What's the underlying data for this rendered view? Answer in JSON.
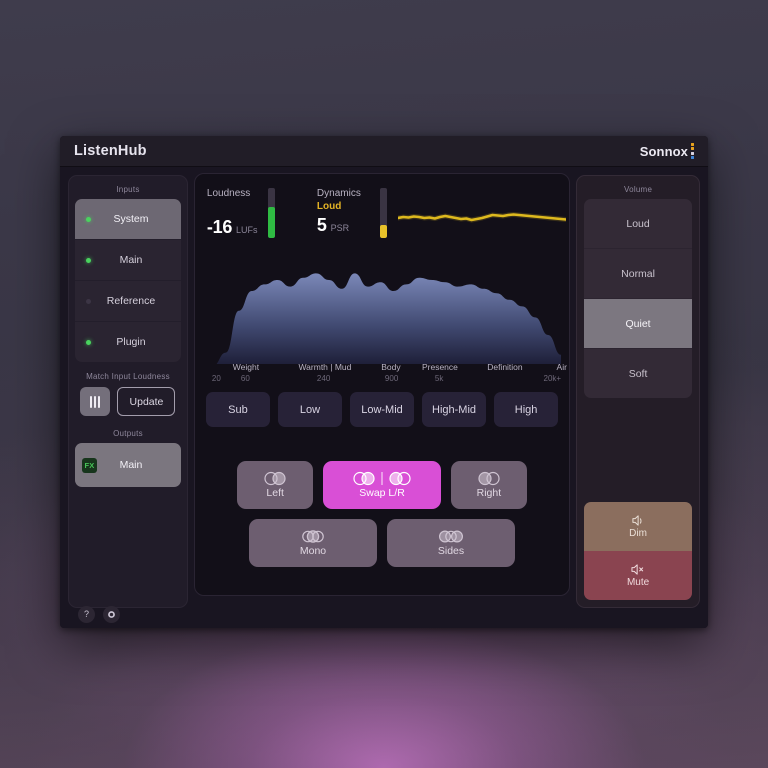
{
  "window": {
    "app_title": "ListenHub",
    "brand": "Sonnox",
    "brand_dot_colors": [
      "#e8a21e",
      "#e8a21e",
      "#d9d4e0",
      "#3f86d8"
    ]
  },
  "sidebar": {
    "inputs_label": "Inputs",
    "inputs": [
      {
        "label": "System",
        "led": "on",
        "selected": true
      },
      {
        "label": "Main",
        "led": "on",
        "selected": false
      },
      {
        "label": "Reference",
        "led": "off",
        "selected": false
      },
      {
        "label": "Plugin",
        "led": "on",
        "selected": false
      }
    ],
    "match_label": "Match Input Loudness",
    "bars_icon": "level-bars-icon",
    "update_label": "Update",
    "outputs_label": "Outputs",
    "outputs": [
      {
        "badge": "FX",
        "label": "Main",
        "selected": true
      }
    ]
  },
  "meters": {
    "loudness": {
      "title": "Loudness",
      "value": "-16",
      "unit": "LUFs",
      "meter_color": "#2fbb43",
      "meter_fill_pct": 62
    },
    "dynamics": {
      "title": "Dynamics",
      "status": "Loud",
      "status_color": "#e3b325",
      "value": "5",
      "unit": "PSR",
      "meter_color": "#e8c22a",
      "meter_fill_pct": 26
    },
    "history_color": "#e8c21f"
  },
  "chart_data": {
    "type": "area",
    "title": "Frequency Spectrum",
    "xlabel": "",
    "ylabel": "",
    "x": [
      20,
      60,
      240,
      900,
      5000,
      20000
    ],
    "tick_labels": [
      "20",
      "60",
      "240",
      "900",
      "5k",
      "20k+"
    ],
    "band_names": [
      "Weight",
      "Warmth | Mud",
      "Body",
      "Presence",
      "Definition",
      "Air"
    ],
    "values": [
      2,
      14,
      52,
      70,
      76,
      80,
      74,
      82,
      86,
      80,
      72,
      86,
      74,
      78,
      70,
      76,
      82,
      80,
      78,
      74,
      76,
      72,
      68,
      62,
      56,
      46,
      30,
      12
    ],
    "ylim": [
      0,
      100
    ],
    "grid": false,
    "legend": "none",
    "fill_top_color": "#7b88b8",
    "fill_bottom_color": "#1b1b33"
  },
  "bands": {
    "scale_names": [
      "Weight",
      "Warmth | Mud",
      "Body",
      "Presence",
      "Definition",
      "Air"
    ],
    "scale_hz": [
      "20",
      "60",
      "240",
      "900",
      "5k",
      "20k+"
    ],
    "buttons": [
      "Sub",
      "Low",
      "Low-Mid",
      "High-Mid",
      "High"
    ]
  },
  "stereo": {
    "row1": [
      {
        "label": "Left",
        "icon": "stereo-left-icon",
        "active": false
      },
      {
        "label": "Swap L/R",
        "icon": "stereo-swap-icon",
        "active": true
      },
      {
        "label": "Right",
        "icon": "stereo-right-icon",
        "active": false
      }
    ],
    "row2": [
      {
        "label": "Mono",
        "icon": "stereo-mono-icon",
        "active": false
      },
      {
        "label": "Sides",
        "icon": "stereo-sides-icon",
        "active": false
      }
    ],
    "active_color": "#d94fd6"
  },
  "volume": {
    "label": "Volume",
    "levels": [
      {
        "label": "Loud",
        "selected": false
      },
      {
        "label": "Normal",
        "selected": false
      },
      {
        "label": "Quiet",
        "selected": true
      },
      {
        "label": "Soft",
        "selected": false
      }
    ],
    "dim": {
      "label": "Dim",
      "icon": "speaker-low-icon",
      "color": "#8b6e5e"
    },
    "mute": {
      "label": "Mute",
      "icon": "speaker-mute-icon",
      "color": "#8a4450"
    }
  },
  "footer": {
    "help_label": "?",
    "help_icon": "question-mark-icon",
    "settings_icon": "gear-icon"
  }
}
